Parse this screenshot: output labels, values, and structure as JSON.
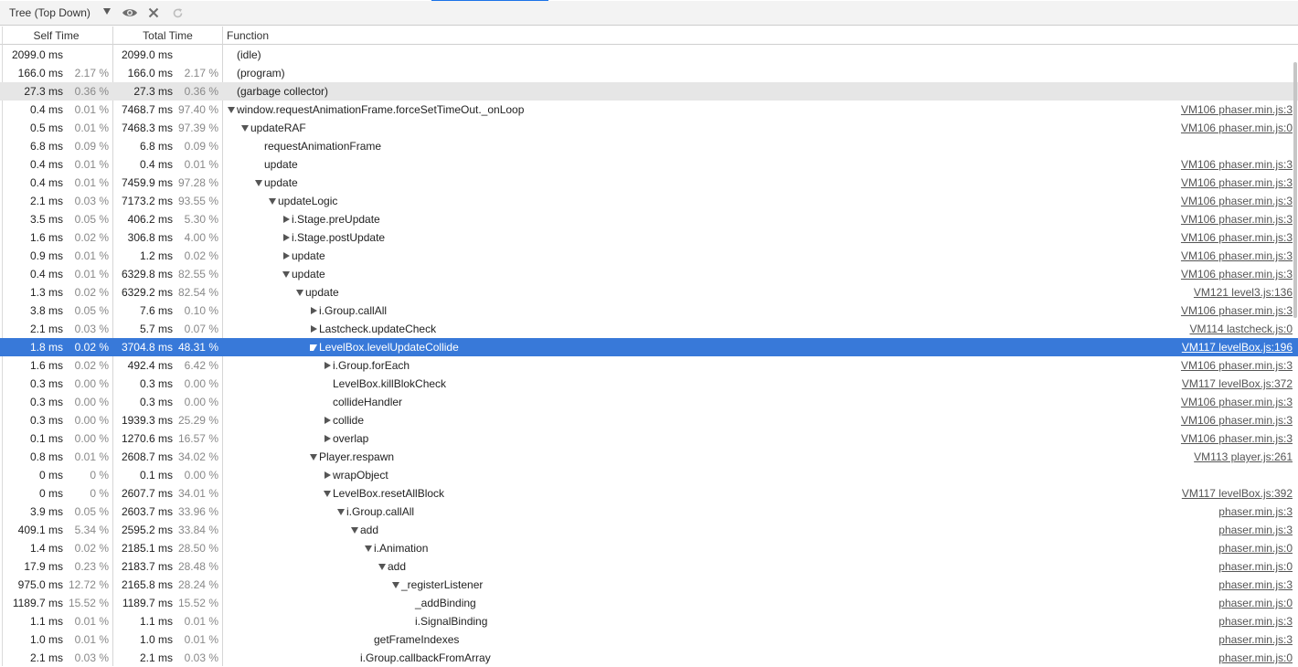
{
  "toolbar": {
    "view_label": "Tree (Top Down)",
    "icons": [
      "eye-icon",
      "close-icon",
      "reload-icon"
    ]
  },
  "columns": {
    "self_time": "Self Time",
    "total_time": "Total Time",
    "function": "Function"
  },
  "colors": {
    "selected": "#3879d9",
    "accent": "#1a73e8",
    "shaded": "#e6e6e6"
  },
  "rows": [
    {
      "self_ms": "2099.0 ms",
      "self_pct": "",
      "total_ms": "2099.0 ms",
      "total_pct": "",
      "depth": 0,
      "expander": "none",
      "name": "(idle)",
      "url": "",
      "state": ""
    },
    {
      "self_ms": "166.0 ms",
      "self_pct": "2.17 %",
      "total_ms": "166.0 ms",
      "total_pct": "2.17 %",
      "depth": 0,
      "expander": "none",
      "name": "(program)",
      "url": "",
      "state": ""
    },
    {
      "self_ms": "27.3 ms",
      "self_pct": "0.36 %",
      "total_ms": "27.3 ms",
      "total_pct": "0.36 %",
      "depth": 0,
      "expander": "none",
      "name": "(garbage collector)",
      "url": "",
      "state": "shaded"
    },
    {
      "self_ms": "0.4 ms",
      "self_pct": "0.01 %",
      "total_ms": "7468.7 ms",
      "total_pct": "97.40 %",
      "depth": 0,
      "expander": "down",
      "name": "window.requestAnimationFrame.forceSetTimeOut._onLoop",
      "url": "VM106 phaser.min.js:3",
      "state": ""
    },
    {
      "self_ms": "0.5 ms",
      "self_pct": "0.01 %",
      "total_ms": "7468.3 ms",
      "total_pct": "97.39 %",
      "depth": 1,
      "expander": "down",
      "name": "updateRAF",
      "url": "VM106 phaser.min.js:0",
      "state": ""
    },
    {
      "self_ms": "6.8 ms",
      "self_pct": "0.09 %",
      "total_ms": "6.8 ms",
      "total_pct": "0.09 %",
      "depth": 2,
      "expander": "none",
      "name": "requestAnimationFrame",
      "url": "",
      "state": ""
    },
    {
      "self_ms": "0.4 ms",
      "self_pct": "0.01 %",
      "total_ms": "0.4 ms",
      "total_pct": "0.01 %",
      "depth": 2,
      "expander": "none",
      "name": "update",
      "url": "VM106 phaser.min.js:3",
      "state": ""
    },
    {
      "self_ms": "0.4 ms",
      "self_pct": "0.01 %",
      "total_ms": "7459.9 ms",
      "total_pct": "97.28 %",
      "depth": 2,
      "expander": "down",
      "name": "update",
      "url": "VM106 phaser.min.js:3",
      "state": ""
    },
    {
      "self_ms": "2.1 ms",
      "self_pct": "0.03 %",
      "total_ms": "7173.2 ms",
      "total_pct": "93.55 %",
      "depth": 3,
      "expander": "down",
      "name": "updateLogic",
      "url": "VM106 phaser.min.js:3",
      "state": ""
    },
    {
      "self_ms": "3.5 ms",
      "self_pct": "0.05 %",
      "total_ms": "406.2 ms",
      "total_pct": "5.30 %",
      "depth": 4,
      "expander": "right",
      "name": "i.Stage.preUpdate",
      "url": "VM106 phaser.min.js:3",
      "state": ""
    },
    {
      "self_ms": "1.6 ms",
      "self_pct": "0.02 %",
      "total_ms": "306.8 ms",
      "total_pct": "4.00 %",
      "depth": 4,
      "expander": "right",
      "name": "i.Stage.postUpdate",
      "url": "VM106 phaser.min.js:3",
      "state": ""
    },
    {
      "self_ms": "0.9 ms",
      "self_pct": "0.01 %",
      "total_ms": "1.2 ms",
      "total_pct": "0.02 %",
      "depth": 4,
      "expander": "right",
      "name": "update",
      "url": "VM106 phaser.min.js:3",
      "state": ""
    },
    {
      "self_ms": "0.4 ms",
      "self_pct": "0.01 %",
      "total_ms": "6329.8 ms",
      "total_pct": "82.55 %",
      "depth": 4,
      "expander": "down",
      "name": "update",
      "url": "VM106 phaser.min.js:3",
      "state": ""
    },
    {
      "self_ms": "1.3 ms",
      "self_pct": "0.02 %",
      "total_ms": "6329.2 ms",
      "total_pct": "82.54 %",
      "depth": 5,
      "expander": "down",
      "name": "update",
      "url": "VM121 level3.js:136",
      "state": ""
    },
    {
      "self_ms": "3.8 ms",
      "self_pct": "0.05 %",
      "total_ms": "7.6 ms",
      "total_pct": "0.10 %",
      "depth": 6,
      "expander": "right",
      "name": "i.Group.callAll",
      "url": "VM106 phaser.min.js:3",
      "state": ""
    },
    {
      "self_ms": "2.1 ms",
      "self_pct": "0.03 %",
      "total_ms": "5.7 ms",
      "total_pct": "0.07 %",
      "depth": 6,
      "expander": "right",
      "name": "Lastcheck.updateCheck",
      "url": "VM114 lastcheck.js:0",
      "state": ""
    },
    {
      "self_ms": "1.8 ms",
      "self_pct": "0.02 %",
      "total_ms": "3704.8 ms",
      "total_pct": "48.31 %",
      "depth": 6,
      "expander": "down",
      "name": "LevelBox.levelUpdateCollide",
      "url": "VM117 levelBox.js:196",
      "state": "selected"
    },
    {
      "self_ms": "1.6 ms",
      "self_pct": "0.02 %",
      "total_ms": "492.4 ms",
      "total_pct": "6.42 %",
      "depth": 7,
      "expander": "right",
      "name": "i.Group.forEach",
      "url": "VM106 phaser.min.js:3",
      "state": ""
    },
    {
      "self_ms": "0.3 ms",
      "self_pct": "0.00 %",
      "total_ms": "0.3 ms",
      "total_pct": "0.00 %",
      "depth": 7,
      "expander": "none",
      "name": "LevelBox.killBlokCheck",
      "url": "VM117 levelBox.js:372",
      "state": ""
    },
    {
      "self_ms": "0.3 ms",
      "self_pct": "0.00 %",
      "total_ms": "0.3 ms",
      "total_pct": "0.00 %",
      "depth": 7,
      "expander": "none",
      "name": "collideHandler",
      "url": "VM106 phaser.min.js:3",
      "state": ""
    },
    {
      "self_ms": "0.3 ms",
      "self_pct": "0.00 %",
      "total_ms": "1939.3 ms",
      "total_pct": "25.29 %",
      "depth": 7,
      "expander": "right",
      "name": "collide",
      "url": "VM106 phaser.min.js:3",
      "state": ""
    },
    {
      "self_ms": "0.1 ms",
      "self_pct": "0.00 %",
      "total_ms": "1270.6 ms",
      "total_pct": "16.57 %",
      "depth": 7,
      "expander": "right",
      "name": "overlap",
      "url": "VM106 phaser.min.js:3",
      "state": ""
    },
    {
      "self_ms": "0.8 ms",
      "self_pct": "0.01 %",
      "total_ms": "2608.7 ms",
      "total_pct": "34.02 %",
      "depth": 6,
      "expander": "down",
      "name": "Player.respawn",
      "url": "VM113 player.js:261",
      "state": ""
    },
    {
      "self_ms": "0 ms",
      "self_pct": "0 %",
      "total_ms": "0.1 ms",
      "total_pct": "0.00 %",
      "depth": 7,
      "expander": "right",
      "name": "wrapObject",
      "url": "",
      "state": ""
    },
    {
      "self_ms": "0 ms",
      "self_pct": "0 %",
      "total_ms": "2607.7 ms",
      "total_pct": "34.01 %",
      "depth": 7,
      "expander": "down",
      "name": "LevelBox.resetAllBlock",
      "url": "VM117 levelBox.js:392",
      "state": ""
    },
    {
      "self_ms": "3.9 ms",
      "self_pct": "0.05 %",
      "total_ms": "2603.7 ms",
      "total_pct": "33.96 %",
      "depth": 8,
      "expander": "down",
      "name": "i.Group.callAll",
      "url": "phaser.min.js:3",
      "state": ""
    },
    {
      "self_ms": "409.1 ms",
      "self_pct": "5.34 %",
      "total_ms": "2595.2 ms",
      "total_pct": "33.84 %",
      "depth": 9,
      "expander": "down",
      "name": "add",
      "url": "phaser.min.js:3",
      "state": ""
    },
    {
      "self_ms": "1.4 ms",
      "self_pct": "0.02 %",
      "total_ms": "2185.1 ms",
      "total_pct": "28.50 %",
      "depth": 10,
      "expander": "down",
      "name": "i.Animation",
      "url": "phaser.min.js:0",
      "state": ""
    },
    {
      "self_ms": "17.9 ms",
      "self_pct": "0.23 %",
      "total_ms": "2183.7 ms",
      "total_pct": "28.48 %",
      "depth": 11,
      "expander": "down",
      "name": "add",
      "url": "phaser.min.js:0",
      "state": ""
    },
    {
      "self_ms": "975.0 ms",
      "self_pct": "12.72 %",
      "total_ms": "2165.8 ms",
      "total_pct": "28.24 %",
      "depth": 12,
      "expander": "down",
      "name": "_registerListener",
      "url": "phaser.min.js:3",
      "state": ""
    },
    {
      "self_ms": "1189.7 ms",
      "self_pct": "15.52 %",
      "total_ms": "1189.7 ms",
      "total_pct": "15.52 %",
      "depth": 13,
      "expander": "none",
      "name": "_addBinding",
      "url": "phaser.min.js:0",
      "state": ""
    },
    {
      "self_ms": "1.1 ms",
      "self_pct": "0.01 %",
      "total_ms": "1.1 ms",
      "total_pct": "0.01 %",
      "depth": 13,
      "expander": "none",
      "name": "i.SignalBinding",
      "url": "phaser.min.js:3",
      "state": ""
    },
    {
      "self_ms": "1.0 ms",
      "self_pct": "0.01 %",
      "total_ms": "1.0 ms",
      "total_pct": "0.01 %",
      "depth": 10,
      "expander": "none",
      "name": "getFrameIndexes",
      "url": "phaser.min.js:3",
      "state": ""
    },
    {
      "self_ms": "2.1 ms",
      "self_pct": "0.03 %",
      "total_ms": "2.1 ms",
      "total_pct": "0.03 %",
      "depth": 9,
      "expander": "none",
      "name": "i.Group.callbackFromArray",
      "url": "phaser.min.js:0",
      "state": ""
    }
  ]
}
